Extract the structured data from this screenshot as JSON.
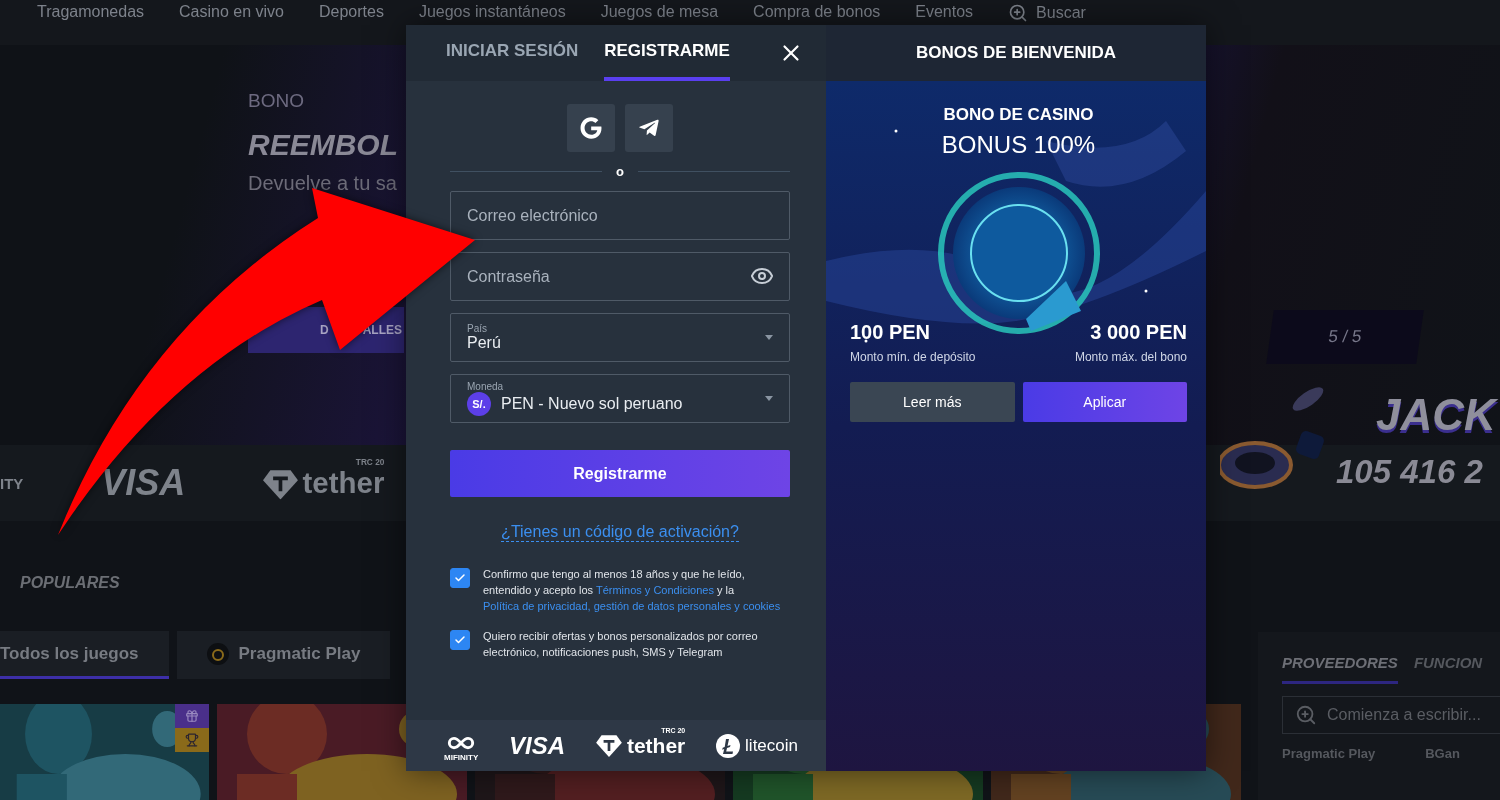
{
  "nav": {
    "items": [
      "Tragamonedas",
      "Casino en vivo",
      "Deportes",
      "Juegos instantáneos",
      "Juegos de mesa",
      "Compra de bonos",
      "Eventos"
    ],
    "search": "Buscar"
  },
  "hero": {
    "eyebrow": "BONO",
    "title": "REEMBOL",
    "subtitle": "Devuelve a tu sa",
    "button": {
      "parts": [
        "D",
        "ALLES"
      ]
    },
    "counter": "5 / 5"
  },
  "jackpot": {
    "title": "JACK",
    "amount": "105 416 2"
  },
  "payments_strip": [
    {
      "kind": "mifinity",
      "label": "ITY"
    },
    {
      "kind": "visa",
      "label": "VISA"
    },
    {
      "kind": "tether",
      "label": "tether",
      "tag": "TRC 20"
    }
  ],
  "popular": {
    "title": "POPULARES",
    "tabs": [
      {
        "label": "Todos los juegos",
        "selected": true
      },
      {
        "label": "Pragmatic Play",
        "selected": false
      }
    ]
  },
  "providers": {
    "tabs": [
      {
        "label": "PROVEEDORES",
        "selected": true
      },
      {
        "label": "FUNCION",
        "selected": false
      }
    ],
    "search": {
      "placeholder": "Comienza a escribir..."
    },
    "items": [
      "Pragmatic Play",
      "BGan"
    ]
  },
  "auth_modal": {
    "tabs": [
      {
        "label": "INICIAR SESIÓN",
        "selected": false
      },
      {
        "label": "REGISTRARME",
        "selected": true
      }
    ],
    "divider": "o",
    "email": {
      "placeholder": "Correo electrónico"
    },
    "password": {
      "placeholder": "Contraseña"
    },
    "country": {
      "label": "País",
      "value": "Perú"
    },
    "currency": {
      "label": "Moneda",
      "symbol": "S/.",
      "value": "PEN - Nuevo sol peruano"
    },
    "submit": "Registrarme",
    "activation_link": "¿Tienes un código de activación?",
    "consents": [
      {
        "checked": true,
        "parts": [
          {
            "kind": "text",
            "text": "Confirmo que tengo al menos 18 años y que he leído, entendido y acepto los "
          },
          {
            "kind": "link",
            "text": "Términos y Condiciones"
          },
          {
            "kind": "text",
            "text": " y la "
          },
          {
            "kind": "link",
            "text": "Política de privacidad, gestión de datos personales y cookies"
          }
        ]
      },
      {
        "checked": true,
        "parts": [
          {
            "kind": "text",
            "text": "Quiero recibir ofertas y bonos personalizados por correo electrónico, notificaciones push, SMS y Telegram"
          }
        ]
      }
    ],
    "footer_payments": [
      {
        "kind": "mifinity",
        "label": "MIFINITY"
      },
      {
        "kind": "visa",
        "label": "VISA"
      },
      {
        "kind": "tether",
        "label": "tether",
        "tag": "TRC 20"
      },
      {
        "kind": "litecoin",
        "label": "litecoin"
      }
    ]
  },
  "bonus_panel": {
    "title": "BONOS DE BIENVENIDA",
    "eyebrow": "BONO DE CASINO",
    "headline": "BONUS 100%",
    "min": {
      "amount": "100 PEN",
      "label": "Monto mín. de depósito"
    },
    "max": {
      "amount": "3 000 PEN",
      "label": "Monto máx. del bono"
    },
    "buttons": [
      {
        "label": "Leer más",
        "kind": "secondary"
      },
      {
        "label": "Aplicar",
        "kind": "primary"
      }
    ]
  }
}
